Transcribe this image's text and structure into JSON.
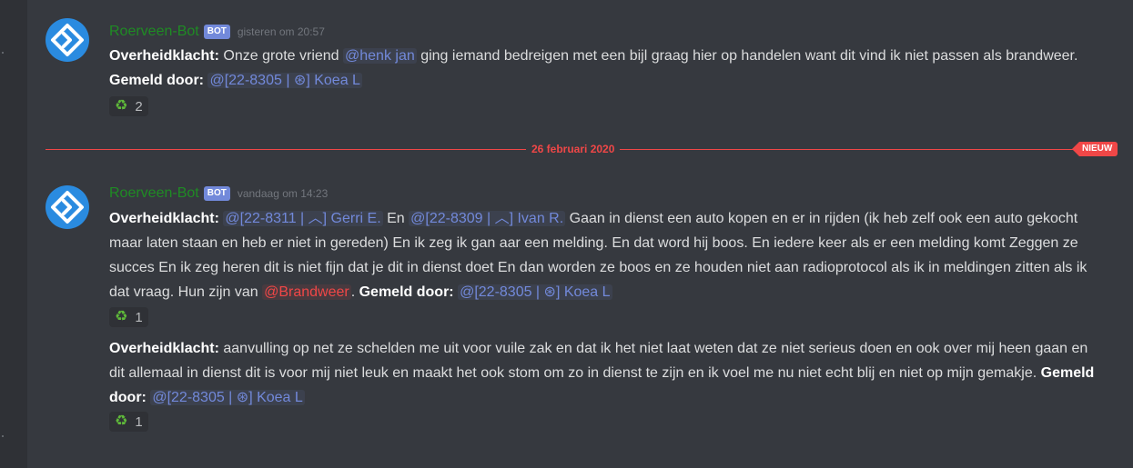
{
  "messages": [
    {
      "username": "Roerveen-Bot",
      "bot_tag": "BOT",
      "timestamp": "gisteren om 20:57",
      "body": {
        "label": "Overheidklacht:",
        "text1": " Onze grote vriend ",
        "mention1": "@henk jan",
        "text2": "  ging iemand bedreigen met een bijl graag hier op handelen want dit vind ik niet passen als brandweer. ",
        "reporter_label": "Gemeld door:",
        "reporter": "@[22-8305 | ⊛] Koea L"
      },
      "reaction": {
        "emoji": "♻",
        "count": "2"
      }
    },
    {
      "username": "Roerveen-Bot",
      "bot_tag": "BOT",
      "timestamp": "vandaag om 14:23",
      "body": {
        "label": "Overheidklacht:",
        "mention1": "@[22-8311  | ︿] Gerri E.",
        "text1": "  En ",
        "mention2": "@[22-8309 | ︿] Ivan R.",
        "text2": " Gaan in dienst een auto kopen en er in rijden (ik heb zelf ook een auto gekocht maar laten staan en heb er niet in gereden) En ik zeg ik gan aar een melding. En dat word hij boos. En iedere keer als er een melding komt Zeggen ze succes En ik zeg heren dit is niet fijn dat je dit in dienst doet En dan worden ze boos en ze houden niet aan radioprotocol als ik in meldingen zitten als ik dat vraag. Hun zijn van ",
        "mention_red": "@Brandweer",
        "text3": ". ",
        "reporter_label": "Gemeld door:",
        "reporter": "@[22-8305 | ⊛] Koea L"
      },
      "reaction": {
        "emoji": "♻",
        "count": "1"
      }
    },
    {
      "body": {
        "label": "Overheidklacht:",
        "text1": " aanvulling op net ze schelden me uit voor vuile zak en dat ik het niet laat weten dat ze niet serieus doen en ook over mij heen gaan en dit allemaal in dienst dit is voor mij niet leuk en maakt het ook stom om zo in dienst te zijn en ik voel me nu niet echt blij en niet op mijn gemakje. ",
        "reporter_label": "Gemeld door:",
        "reporter": "@[22-8305 | ⊛] Koea L"
      },
      "reaction": {
        "emoji": "♻",
        "count": "1"
      }
    }
  ],
  "divider": {
    "date": "26 februari 2020",
    "new_label": "NIEUW"
  },
  "colors": {
    "background": "#36393f",
    "username": "#1f8b24",
    "bot_tag": "#7289da",
    "mention": "#7289da",
    "mention_red": "#f04747",
    "divider": "#f04747",
    "avatar": "#2a8be0"
  },
  "icons": {
    "avatar": "bot-logo-icon",
    "reaction": "recycle-icon"
  }
}
